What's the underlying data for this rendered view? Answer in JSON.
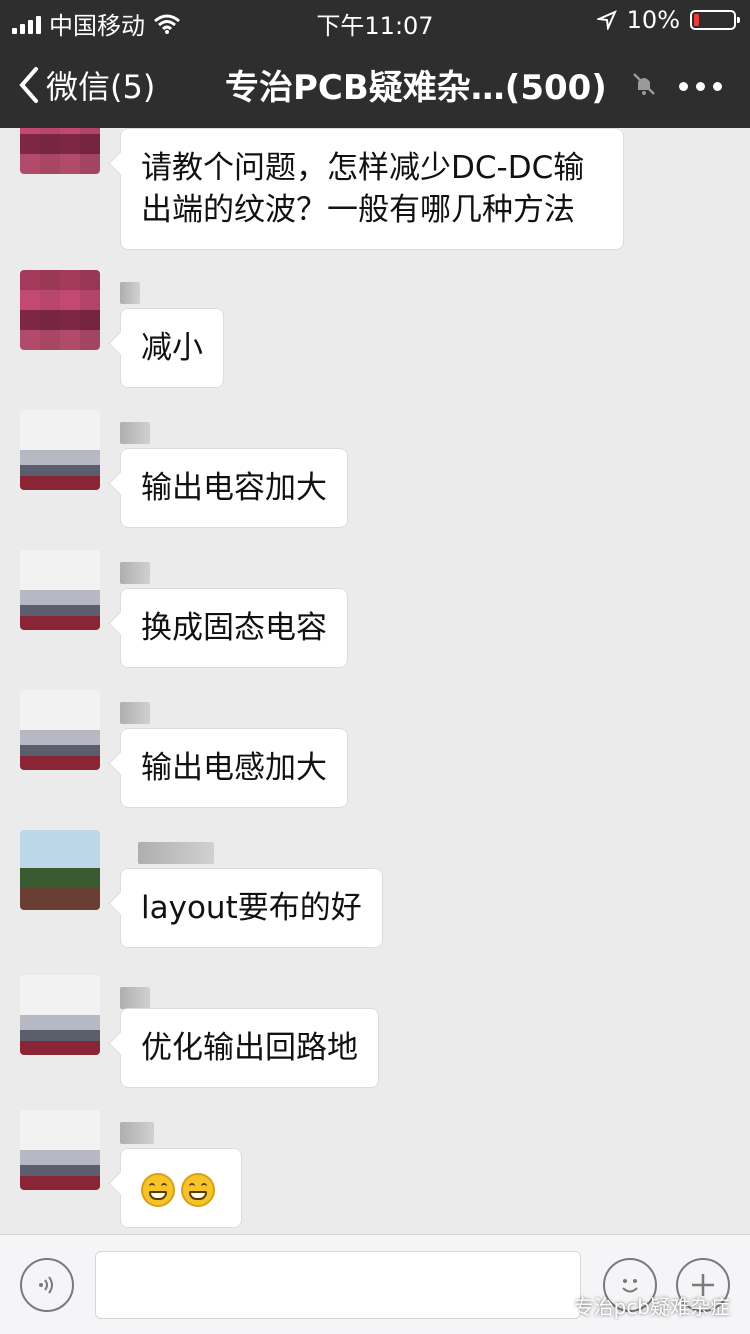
{
  "status_bar": {
    "carrier": "中国移动",
    "time": "下午11:07",
    "battery": "10%"
  },
  "nav": {
    "back_label": "微信(5)",
    "title": "专治PCB疑难杂…(500)"
  },
  "messages": [
    {
      "text": "请教个问题，怎样减少DC-DC输出端的纹波？一般有哪几种方法",
      "avatar": "pink"
    },
    {
      "text": "减小",
      "avatar": "pink"
    },
    {
      "text": "输出电容加大",
      "avatar": "city"
    },
    {
      "text": "换成固态电容",
      "avatar": "city"
    },
    {
      "text": "输出电感加大",
      "avatar": "city"
    },
    {
      "text": "layout要布的好",
      "avatar": "tree"
    },
    {
      "text": "优化输出回路地",
      "avatar": "city"
    },
    {
      "text": "",
      "avatar": "city",
      "emoji_count": 2
    }
  ],
  "input": {
    "placeholder": ""
  },
  "watermark": "专治pcb疑难杂症",
  "colors": {
    "bar_bg": "#2e2e2e",
    "chat_bg": "#ebebeb",
    "bubble_bg": "#ffffff",
    "battery_low": "#f03a3a"
  },
  "icons": {
    "voice": "voice-icon",
    "emoji": "emoji-icon",
    "plus": "plus-icon",
    "mute": "mute-icon",
    "more": "more-icon"
  }
}
